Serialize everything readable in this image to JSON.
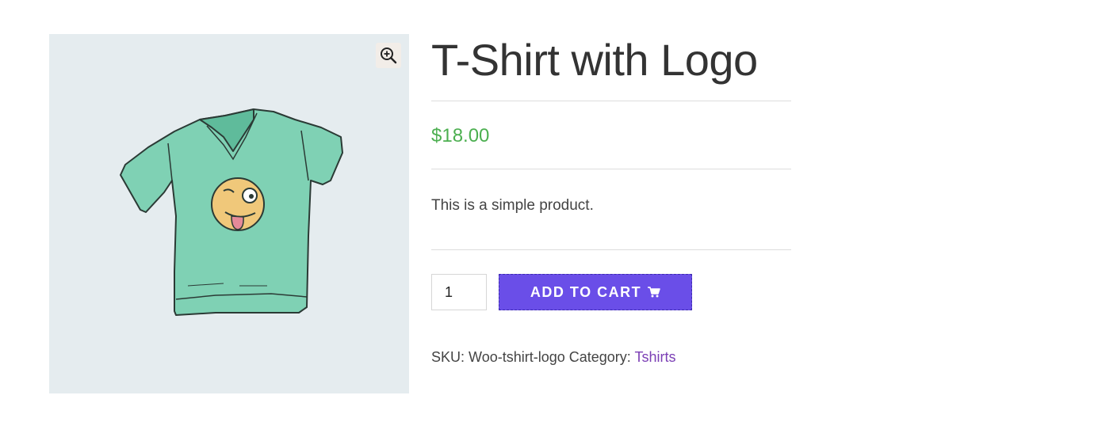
{
  "product": {
    "title": "T-Shirt with Logo",
    "price": "$18.00",
    "description": "This is a simple product.",
    "quantity": "1",
    "add_to_cart_label": "ADD TO CART",
    "sku_label": "SKU:",
    "sku_value": "Woo-tshirt-logo",
    "category_label": "Category:",
    "category_value": "Tshirts",
    "image_icon": "tshirt-with-winking-emoji",
    "zoom_icon": "zoom-in-icon",
    "cart_icon": "cart-icon"
  },
  "colors": {
    "price": "#4caf50",
    "button": "#6a4ee8",
    "category_link": "#7b3fb5",
    "gallery_bg": "#e5ecef"
  }
}
